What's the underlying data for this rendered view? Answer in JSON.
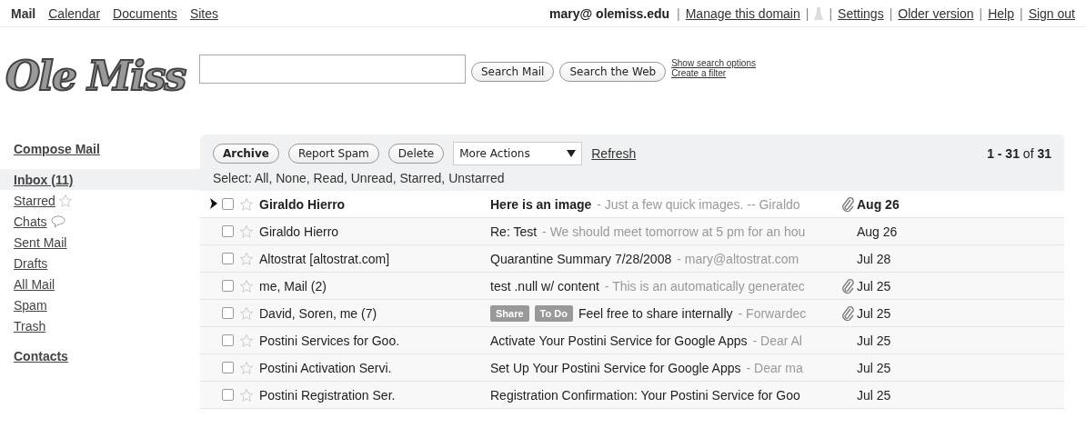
{
  "top_nav": [
    {
      "label": "Mail",
      "selected": true
    },
    {
      "label": "Calendar",
      "selected": false
    },
    {
      "label": "Documents",
      "selected": false
    },
    {
      "label": "Sites",
      "selected": false
    }
  ],
  "account": {
    "email": "mary@ olemiss.edu",
    "links": [
      {
        "kind": "separator",
        "label": "|"
      },
      {
        "kind": "link",
        "label": "Manage this domain"
      },
      {
        "kind": "separator",
        "label": "|"
      },
      {
        "kind": "icon"
      },
      {
        "kind": "separator",
        "label": "|"
      },
      {
        "kind": "link",
        "label": "Settings"
      },
      {
        "kind": "separator",
        "label": "|"
      },
      {
        "kind": "link",
        "label": "Older version"
      },
      {
        "kind": "separator",
        "label": "|"
      },
      {
        "kind": "link",
        "label": "Help"
      },
      {
        "kind": "separator",
        "label": "|"
      },
      {
        "kind": "link",
        "label": "Sign out"
      }
    ]
  },
  "logo": "Ole Miss",
  "search": {
    "buttons": [
      "Search Mail",
      "Search the Web"
    ],
    "links": [
      "Show search options",
      "Create a filter"
    ]
  },
  "sidebar": {
    "compose": "Compose Mail",
    "items": [
      {
        "label": "Inbox (11)",
        "selected": true,
        "kind": "plain"
      },
      {
        "label": "Starred",
        "selected": false,
        "kind": "starred"
      },
      {
        "label": "Chats",
        "selected": false,
        "kind": "chats"
      },
      {
        "label": "Sent Mail",
        "selected": false,
        "kind": "plain"
      },
      {
        "label": "Drafts",
        "selected": false,
        "kind": "plain"
      },
      {
        "label": "All Mail",
        "selected": false,
        "kind": "plain"
      },
      {
        "label": "Spam",
        "selected": false,
        "kind": "plain"
      },
      {
        "label": "Trash",
        "selected": false,
        "kind": "plain"
      }
    ],
    "contacts": "Contacts"
  },
  "toolbar": {
    "buttons": [
      "Archive",
      "Report Spam",
      "Delete"
    ],
    "more_actions": "More Actions",
    "refresh": "Refresh",
    "count_from": "1 - 31",
    "count_of": "of",
    "count_total": "31",
    "select": "Select: All, None, Read, Unread, Starred, Unstarred"
  },
  "messages": [
    {
      "pointer": true,
      "checked": false,
      "starred": false,
      "unread": true,
      "sender": "Giraldo Hierro",
      "subject": "Here is an image",
      "snippet": "- Just a few quick images. -- Giraldo",
      "attachment": true,
      "date": "Aug 26"
    },
    {
      "pointer": false,
      "checked": false,
      "starred": false,
      "unread": false,
      "sender": "Giraldo Hierro",
      "subject": "Re: Test",
      "snippet": "- We should meet tomorrow at 5 pm for an hou",
      "attachment": false,
      "date": "Aug 26"
    },
    {
      "pointer": false,
      "checked": false,
      "starred": false,
      "unread": false,
      "sender": "Altostrat [altostrat.com]",
      "subject": "Quarantine Summary 7/28/2008",
      "snippet": "- mary@altostrat.com",
      "attachment": false,
      "date": "Jul 28"
    },
    {
      "pointer": false,
      "checked": false,
      "starred": false,
      "unread": false,
      "sender": "me, Mail (2)",
      "subject": "test .null w/ content",
      "snippet": "- This is an automatically generatec",
      "attachment": true,
      "date": "Jul 25"
    },
    {
      "pointer": false,
      "checked": false,
      "starred": false,
      "unread": false,
      "sender": "David, Soren, me (7)",
      "labels": [
        "Share",
        "To Do"
      ],
      "subject": "Feel free to share internally",
      "snippet": "- Forwardec",
      "attachment": true,
      "date": "Jul 25"
    },
    {
      "pointer": false,
      "checked": false,
      "starred": false,
      "unread": false,
      "sender": "Postini Services for Goo.",
      "subject": "Activate Your Postini Service for Google Apps",
      "snippet": "- Dear Al",
      "attachment": false,
      "date": "Jul 25"
    },
    {
      "pointer": false,
      "checked": false,
      "starred": false,
      "unread": false,
      "sender": "Postini Activation Servi.",
      "subject": "Set Up Your Postini Service for Google Apps",
      "snippet": "- Dear ma",
      "attachment": false,
      "date": "Jul 25"
    },
    {
      "pointer": false,
      "checked": false,
      "starred": false,
      "unread": false,
      "sender": "Postini Registration Ser.",
      "subject": "Registration Confirmation: Your Postini Service for Goo",
      "attachment": false,
      "date": "Jul 25"
    }
  ]
}
